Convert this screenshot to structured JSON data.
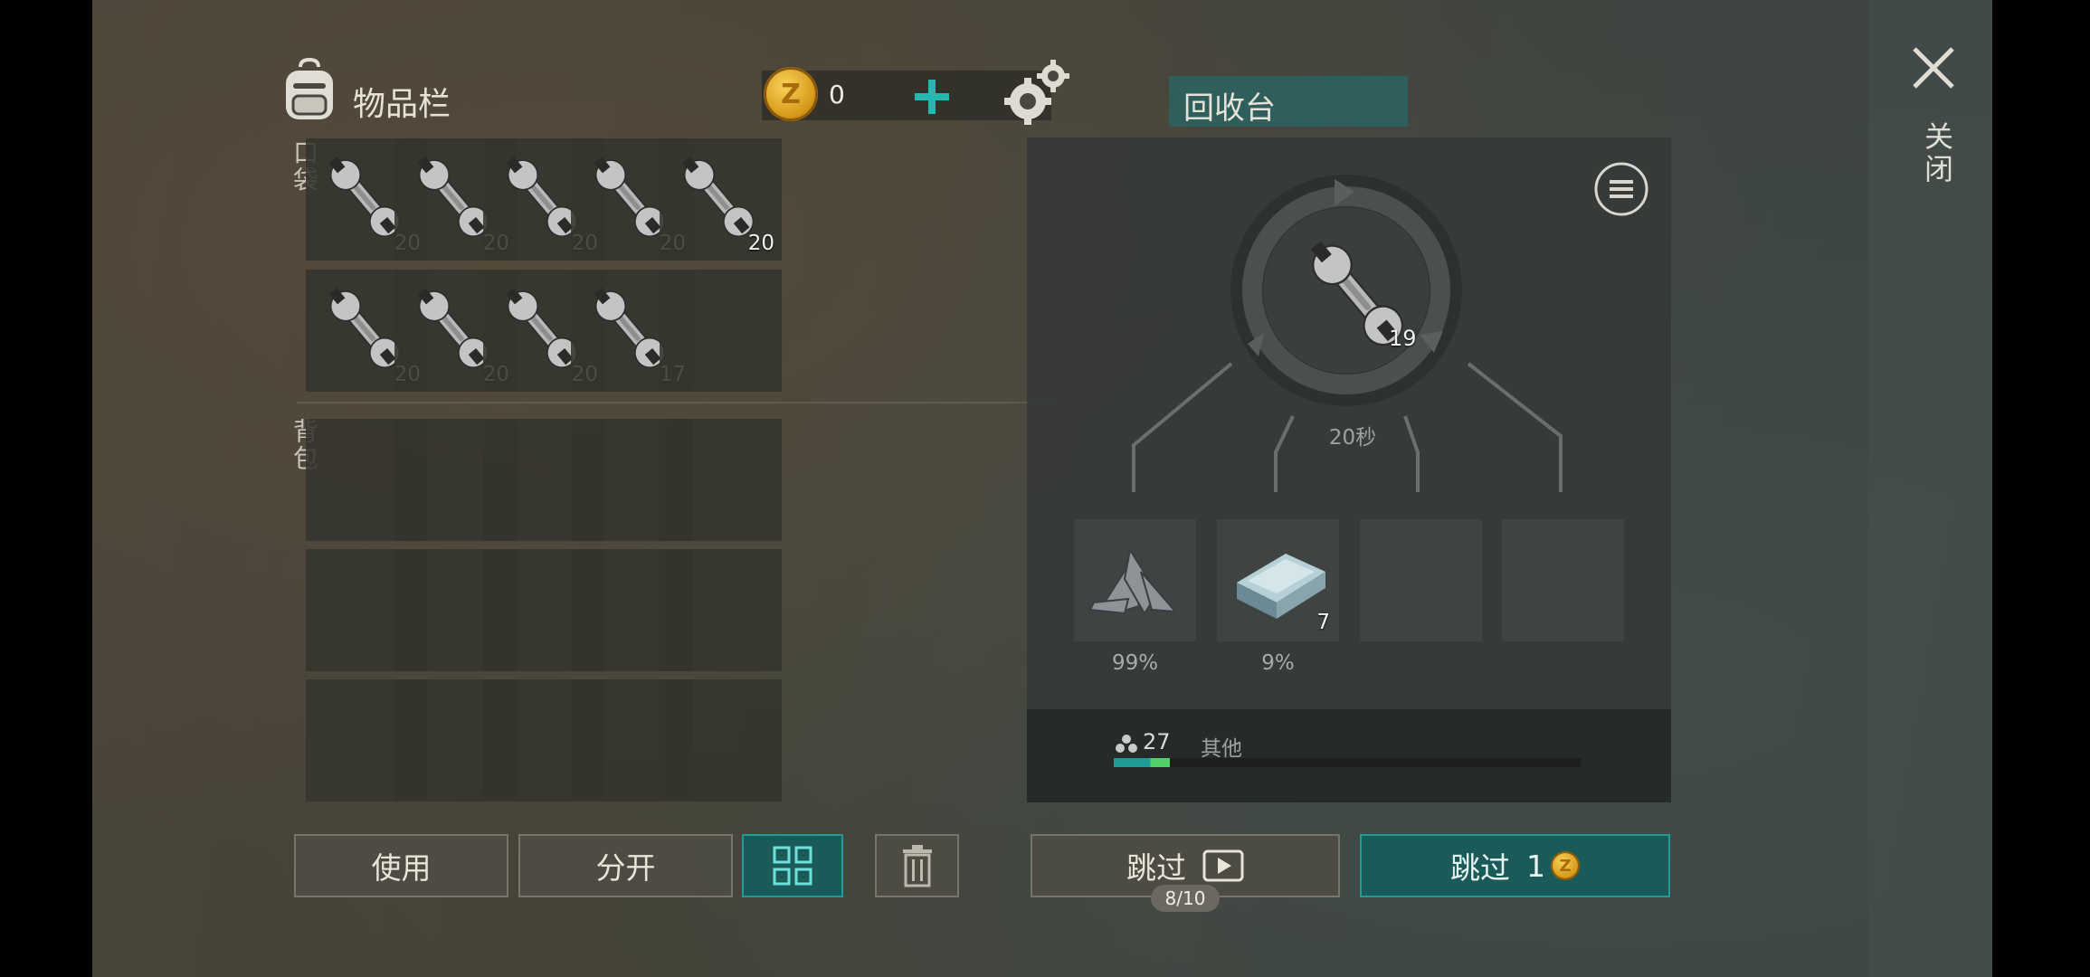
{
  "inventory": {
    "title": "物品栏",
    "coin_balance": "0",
    "add_label": "+",
    "pocket_label": "口袋",
    "backpack_label": "背包",
    "pocket_slots": [
      {
        "item": "wrench",
        "count": "20"
      },
      {
        "item": "wrench",
        "count": "20"
      },
      {
        "item": "wrench",
        "count": "20"
      },
      {
        "item": "wrench",
        "count": "20"
      },
      {
        "item": "wrench",
        "count": "20"
      },
      {
        "item": "wrench",
        "count": "20"
      },
      {
        "item": "wrench",
        "count": "20"
      },
      {
        "item": "wrench",
        "count": "20"
      },
      {
        "item": "wrench",
        "count": "17"
      },
      {
        "item": "",
        "count": ""
      }
    ],
    "backpack_slots": 15
  },
  "actions": {
    "use_label": "使用",
    "split_label": "分开"
  },
  "recycler": {
    "title": "回收台",
    "input_item": "wrench",
    "input_count": "19",
    "time_label": "20秒",
    "outputs": [
      {
        "item": "scrap-metal",
        "count": "",
        "chance": "99%"
      },
      {
        "item": "metal-ingot",
        "count": "7",
        "chance": "9%"
      },
      {
        "item": "",
        "count": "",
        "chance": ""
      },
      {
        "item": "",
        "count": "",
        "chance": ""
      }
    ],
    "capacity_value": "27",
    "capacity_label": "其他",
    "capacity_fill": 0.12
  },
  "skip": {
    "video_label": "跳过",
    "video_counter": "8/10",
    "coin_label": "跳过",
    "coin_cost": "1"
  },
  "close": {
    "label": "关闭"
  },
  "colors": {
    "accent_teal": "#1f9c96",
    "recycler_title_bg": "#2f5f5c",
    "progress_green": "#4fd06a"
  },
  "icons": [
    "backpack-icon",
    "coin-icon",
    "plus-icon",
    "gears-icon",
    "wrench-icon",
    "menu-icon",
    "recycle-arrows-icon",
    "scrap-metal-icon",
    "metal-ingot-icon",
    "grid-view-icon",
    "trash-icon",
    "video-play-icon",
    "close-icon",
    "resource-dots-icon"
  ]
}
